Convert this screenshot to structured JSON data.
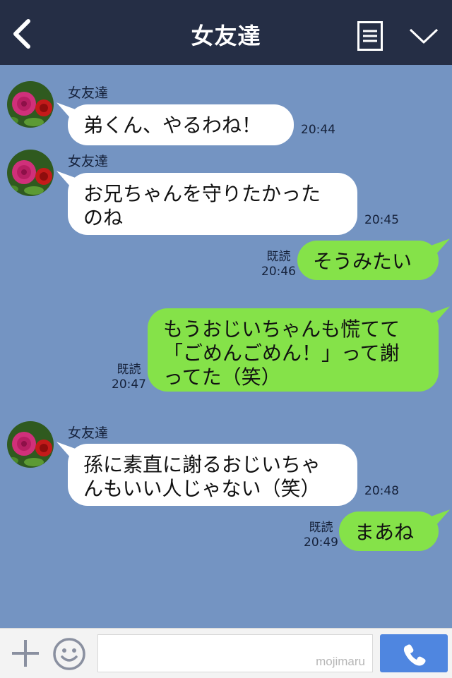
{
  "header": {
    "title": "女友達"
  },
  "messages": [
    {
      "dir": "in",
      "sender": "女友達",
      "text": "弟くん、やるわね！",
      "time": "20:44"
    },
    {
      "dir": "in",
      "sender": "女友達",
      "text": "お兄ちゃんを守りたかった\nのね",
      "time": "20:45"
    },
    {
      "dir": "out",
      "read": "既読",
      "text": "そうみたい",
      "time": "20:46"
    },
    {
      "dir": "out",
      "read": "既読",
      "text": "もうおじいちゃんも慌てて\n「ごめんごめん！」って謝\nってた（笑）",
      "time": "20:47"
    },
    {
      "dir": "in",
      "sender": "女友達",
      "text": "孫に素直に謝るおじいちゃ\nんもいい人じゃない（笑）",
      "time": "20:48"
    },
    {
      "dir": "out",
      "read": "既読",
      "text": "まあね",
      "time": "20:49"
    }
  ],
  "input": {
    "watermark": "mojimaru"
  },
  "colors": {
    "header_bg": "#252e45",
    "chat_bg": "#7494c2",
    "bubble_out": "#85e249",
    "bubble_in": "#ffffff",
    "call_button": "#4f86e0"
  }
}
